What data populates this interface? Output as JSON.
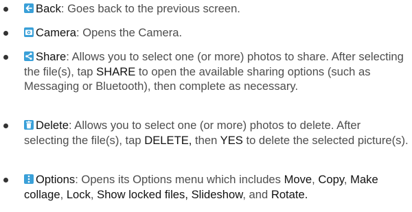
{
  "icon_color": "#3aa0d8",
  "items": [
    {
      "icon": "back-arrow-icon",
      "term": "Back",
      "parts": [
        ": Goes back to the previous screen."
      ]
    },
    {
      "icon": "camera-icon",
      "term": "Camera",
      "parts": [
        ": Opens the Camera."
      ]
    },
    {
      "icon": "share-icon",
      "term": "Share",
      "parts": [
        ": Allows you to select one (or more) photos to share. After selecting the file(s), tap ",
        "SHARE",
        " to open the available sharing options (such as Messaging or Bluetooth), then complete as necessary."
      ]
    },
    {
      "icon": "trash-icon",
      "term": "Delete",
      "parts": [
        ": Allows you to select one (or more) photos to delete. After selecting the file(s), tap ",
        "DELETE,",
        " then ",
        "YES",
        " to delete the selected picture(s)."
      ]
    },
    {
      "icon": "more-options-icon",
      "term": "Options",
      "parts": [
        ": Opens its Options menu which includes ",
        "Move",
        ", ",
        "Copy",
        ", ",
        "Make collage",
        ", ",
        "Lock",
        ", ",
        "Show locked files,",
        " ",
        "Slideshow",
        ", and ",
        "Rotate."
      ]
    }
  ]
}
